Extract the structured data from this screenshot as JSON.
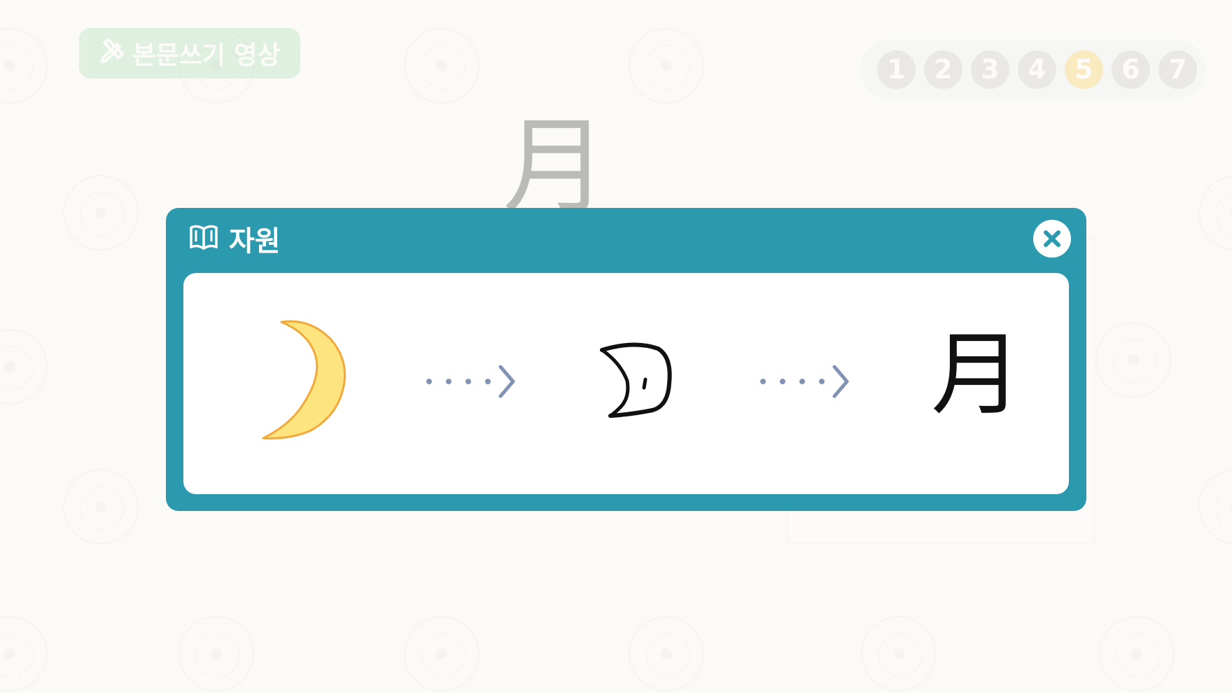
{
  "header": {
    "video_button_label": "본문쓰기 영상"
  },
  "steps": {
    "items": [
      "1",
      "2",
      "3",
      "4",
      "5",
      "6",
      "7"
    ],
    "active_index": 4
  },
  "main": {
    "character": "月"
  },
  "modal": {
    "title": "자원",
    "evolution": {
      "stage1_icon": "crescent-moon-icon",
      "stage2_icon": "oracle-bone-moon-glyph",
      "stage3_character": "月",
      "arrow_icon": "dotted-arrow-icon"
    }
  },
  "colors": {
    "modal_teal": "#2b9aae",
    "video_button_green": "#aedcb8",
    "active_step_yellow": "#f7cf59",
    "moon_fill": "#fde47f",
    "moon_stroke": "#f2a93a",
    "arrow_color": "#8292b4"
  }
}
